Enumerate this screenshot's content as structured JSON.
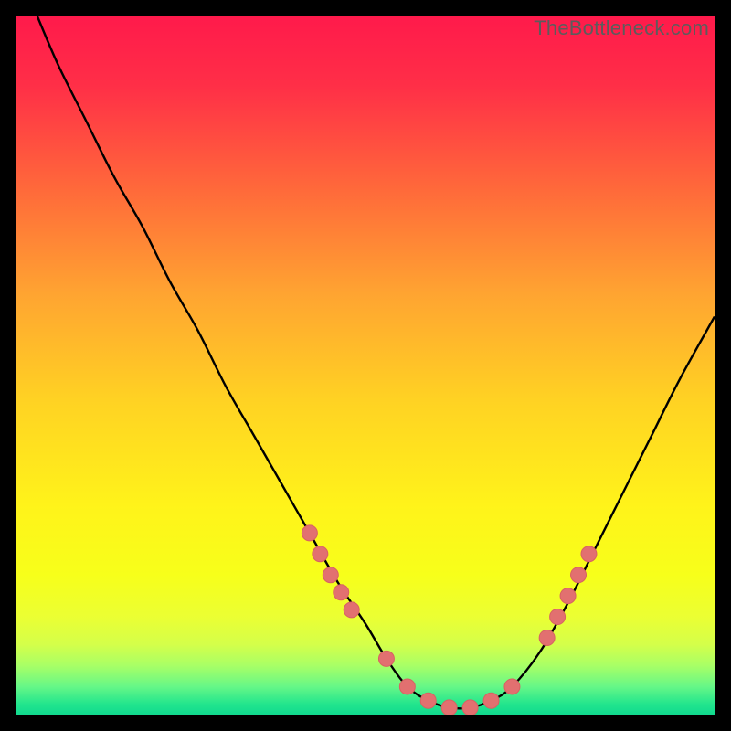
{
  "watermark": "TheBottleneck.com",
  "colors": {
    "gradient_stops": [
      {
        "offset": 0.0,
        "color": "#ff1a4b"
      },
      {
        "offset": 0.1,
        "color": "#ff2f47"
      },
      {
        "offset": 0.25,
        "color": "#ff6a3a"
      },
      {
        "offset": 0.4,
        "color": "#ffa531"
      },
      {
        "offset": 0.55,
        "color": "#ffd223"
      },
      {
        "offset": 0.7,
        "color": "#fff31a"
      },
      {
        "offset": 0.8,
        "color": "#f7ff1a"
      },
      {
        "offset": 0.86,
        "color": "#ebff33"
      },
      {
        "offset": 0.9,
        "color": "#d4ff4a"
      },
      {
        "offset": 0.93,
        "color": "#a8ff66"
      },
      {
        "offset": 0.96,
        "color": "#66f787"
      },
      {
        "offset": 0.985,
        "color": "#22e58d"
      },
      {
        "offset": 1.0,
        "color": "#11d98e"
      }
    ],
    "curve": "#000000",
    "marker_fill": "#e27070",
    "marker_stroke": "#d86262"
  },
  "chart_data": {
    "type": "line",
    "title": "",
    "xlabel": "",
    "ylabel": "",
    "xlim": [
      0,
      100
    ],
    "ylim": [
      0,
      100
    ],
    "series": [
      {
        "name": "bottleneck-curve",
        "x": [
          3,
          6,
          10,
          14,
          18,
          22,
          26,
          30,
          34,
          38,
          42,
          46,
          50,
          53,
          56,
          59,
          62,
          65,
          68,
          71,
          75,
          79,
          83,
          87,
          91,
          95,
          100
        ],
        "y": [
          100,
          93,
          85,
          77,
          70,
          62,
          55,
          47,
          40,
          33,
          26,
          19,
          13,
          8,
          4,
          2,
          1,
          1,
          2,
          4,
          9,
          16,
          24,
          32,
          40,
          48,
          57
        ]
      }
    ],
    "markers": {
      "name": "highlight-dots",
      "points": [
        {
          "x": 42,
          "y": 26
        },
        {
          "x": 43.5,
          "y": 23
        },
        {
          "x": 45,
          "y": 20
        },
        {
          "x": 46.5,
          "y": 17.5
        },
        {
          "x": 48,
          "y": 15
        },
        {
          "x": 53,
          "y": 8
        },
        {
          "x": 56,
          "y": 4
        },
        {
          "x": 59,
          "y": 2
        },
        {
          "x": 62,
          "y": 1
        },
        {
          "x": 65,
          "y": 1
        },
        {
          "x": 68,
          "y": 2
        },
        {
          "x": 71,
          "y": 4
        },
        {
          "x": 76,
          "y": 11
        },
        {
          "x": 77.5,
          "y": 14
        },
        {
          "x": 79,
          "y": 17
        },
        {
          "x": 80.5,
          "y": 20
        },
        {
          "x": 82,
          "y": 23
        }
      ]
    }
  }
}
